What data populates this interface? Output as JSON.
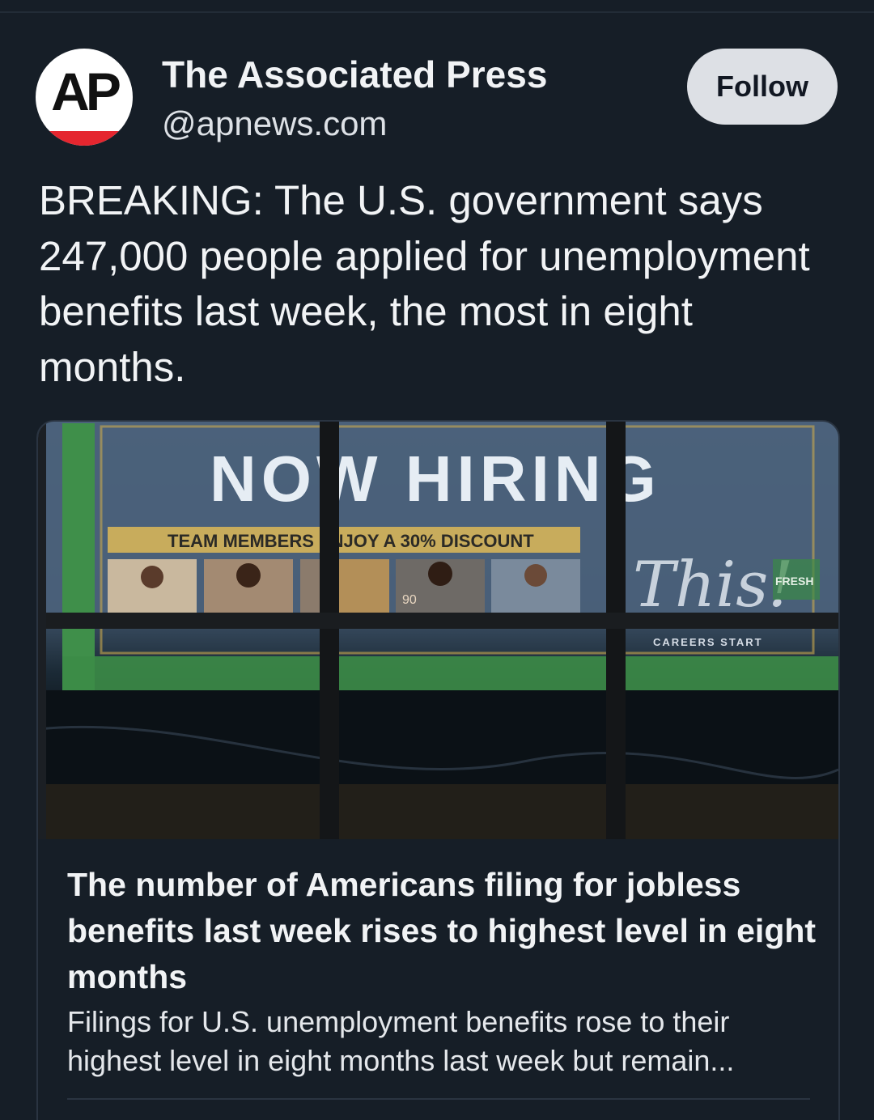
{
  "post": {
    "author": {
      "avatar_text": "AP",
      "display_name": "The Associated Press",
      "handle": "@apnews.com"
    },
    "follow_label": "Follow",
    "text": "BREAKING: The U.S. government says 247,000 people applied for unemployment benefits last week, the most in eight months.",
    "link_card": {
      "image_signage": {
        "headline": "NOW HIRING",
        "banner": "TEAM MEMBERS ENJOY A 30% DISCOUNT",
        "script_word": "This!",
        "small_label": "CAREERS START",
        "store_logo": "FRESH",
        "price_tag": "90"
      },
      "title": "The number of Americans filing for jobless benefits last week rises to highest level in eight months",
      "description": "Filings for U.S. unemployment benefits rose to their highest level in eight months last week but remain..."
    }
  },
  "colors": {
    "background": "#161e27",
    "text_primary": "#f1f3f5",
    "follow_button_bg": "#dde0e5",
    "ap_red": "#e5262f",
    "card_border": "#2a3441"
  }
}
